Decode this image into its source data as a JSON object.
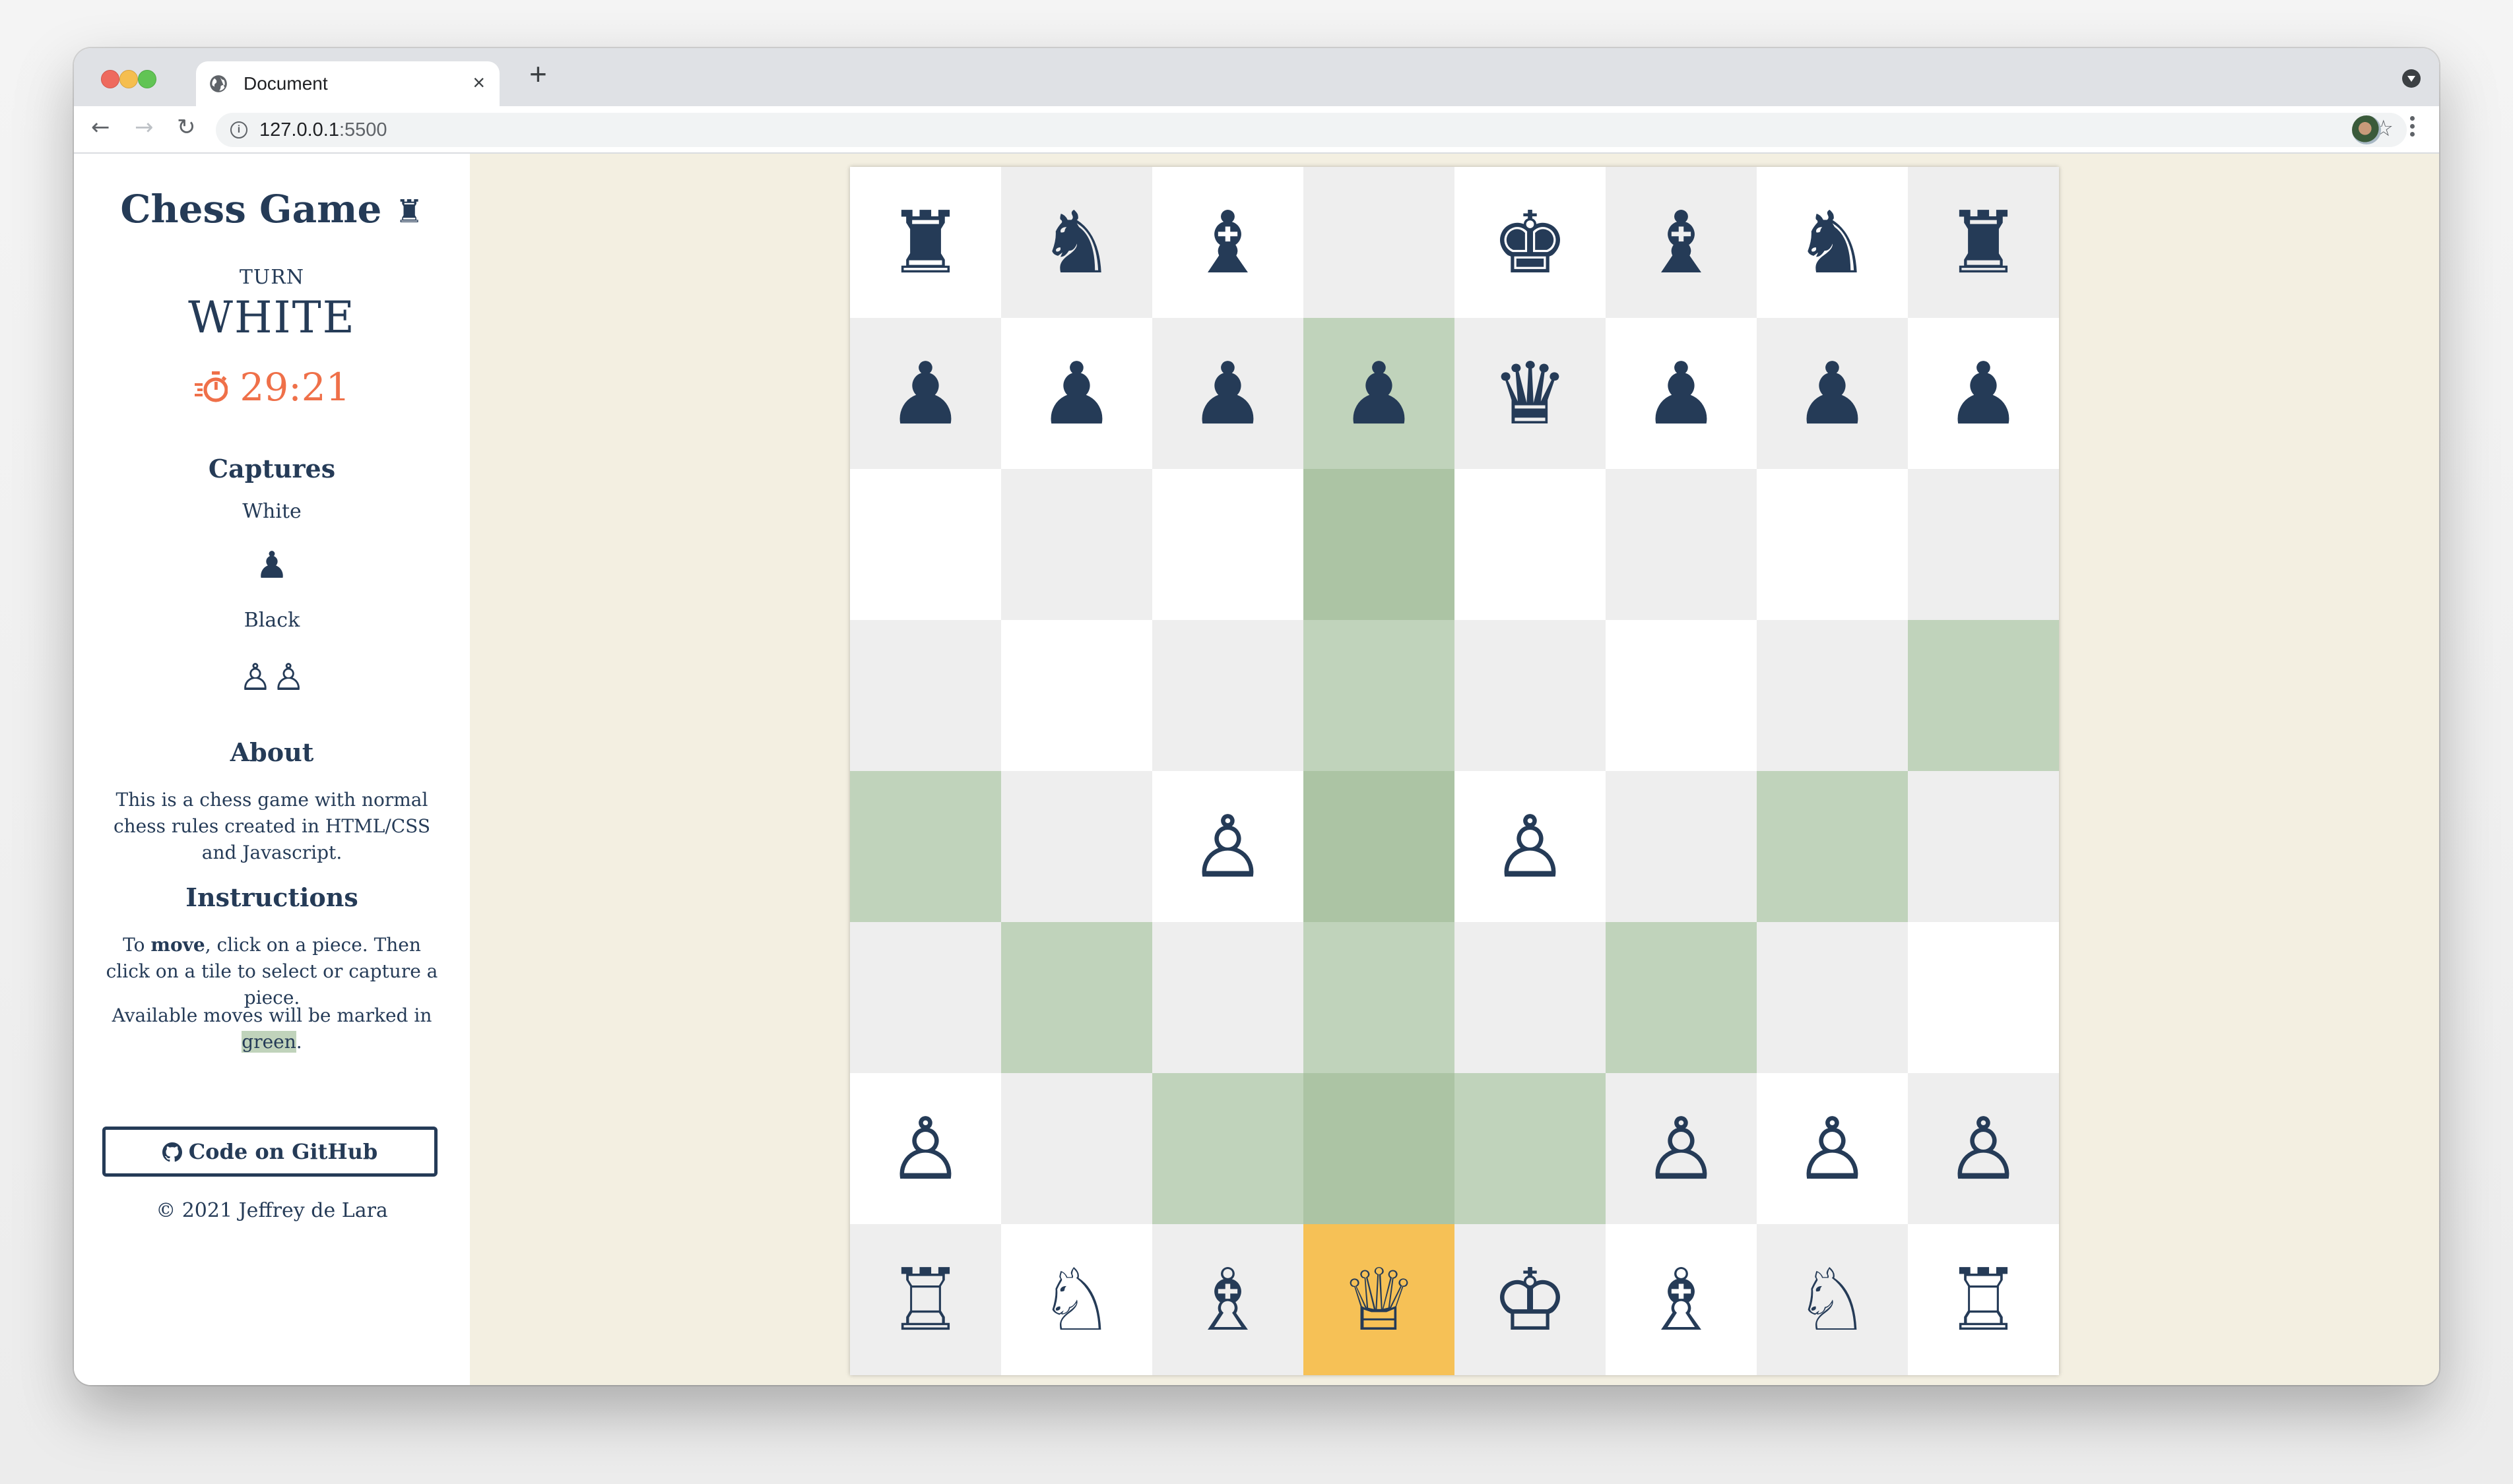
{
  "browser": {
    "tab_title": "Document",
    "tab_close": "×",
    "new_tab": "+",
    "url_host": "127.0.0.1",
    "url_port": ":5500",
    "nav_back": "←",
    "nav_forward": "→",
    "nav_reload": "↻",
    "info": "i",
    "star": "☆"
  },
  "sidebar": {
    "title": "Chess Game",
    "title_icon": "♜",
    "turn_label": "TURN",
    "turn_value": "WHITE",
    "timer": "29:21",
    "captures_heading": "Captures",
    "white_label": "White",
    "white_captures": "♟",
    "black_label": "Black",
    "black_captures": "♙♙",
    "about_heading": "About",
    "about_text": "This is a chess game with normal chess rules created in HTML/CSS and Javascript.",
    "instructions_heading": "Instructions",
    "instr_pre": "To ",
    "instr_bold": "move",
    "instr_post": ", click on a piece. Then click on a tile to select or capture a piece.",
    "avail_pre": "Available moves will be marked in ",
    "avail_green": "green",
    "avail_post": ".",
    "github_button": "Code on GitHub",
    "copyright": "© 2021 Jeffrey de Lara"
  },
  "colors": {
    "text": "#253b57",
    "timer": "#ef7049",
    "page_bg": "#f3efe1",
    "tile_light": "#ffffff",
    "tile_dark": "#eeeeee",
    "move_light": "#c0d3bb",
    "move_dark": "#acc4a4",
    "selected": "#f6c156"
  },
  "board": {
    "ranks": [
      [
        "♜",
        "♞",
        "♝",
        "",
        "♚",
        "♝",
        "♞",
        "♜"
      ],
      [
        "♟",
        "♟",
        "♟",
        "♟",
        "♛",
        "♟",
        "♟",
        "♟"
      ],
      [
        "",
        "",
        "",
        "",
        "",
        "",
        "",
        ""
      ],
      [
        "",
        "",
        "",
        "",
        "",
        "",
        "",
        ""
      ],
      [
        "",
        "",
        "♙",
        "",
        "♙",
        "",
        "",
        ""
      ],
      [
        "",
        "",
        "",
        "",
        "",
        "",
        "",
        ""
      ],
      [
        "♙",
        "",
        "",
        "",
        "",
        "♙",
        "♙",
        "♙"
      ],
      [
        "♖",
        "♘",
        "♗",
        "♕",
        "♔",
        "♗",
        "♘",
        "♖"
      ]
    ],
    "piece_names": [
      [
        "black-rook",
        "black-knight",
        "black-bishop",
        "",
        "black-king",
        "black-bishop",
        "black-knight",
        "black-rook"
      ],
      [
        "black-pawn",
        "black-pawn",
        "black-pawn",
        "black-pawn",
        "black-queen",
        "black-pawn",
        "black-pawn",
        "black-pawn"
      ],
      [
        "",
        "",
        "",
        "",
        "",
        "",
        "",
        ""
      ],
      [
        "",
        "",
        "",
        "",
        "",
        "",
        "",
        ""
      ],
      [
        "",
        "",
        "white-pawn",
        "",
        "white-pawn",
        "",
        "",
        ""
      ],
      [
        "",
        "",
        "",
        "",
        "",
        "",
        "",
        ""
      ],
      [
        "white-pawn",
        "",
        "",
        "",
        "",
        "white-pawn",
        "white-pawn",
        "white-pawn"
      ],
      [
        "white-rook",
        "white-knight",
        "white-bishop",
        "white-queen",
        "white-king",
        "white-bishop",
        "white-knight",
        "white-rook"
      ]
    ],
    "selected": "d1",
    "available_moves": [
      "d7",
      "d6",
      "d5",
      "h5",
      "a4",
      "d4",
      "g4",
      "b3",
      "d3",
      "f3",
      "c2",
      "d2",
      "e2"
    ]
  }
}
